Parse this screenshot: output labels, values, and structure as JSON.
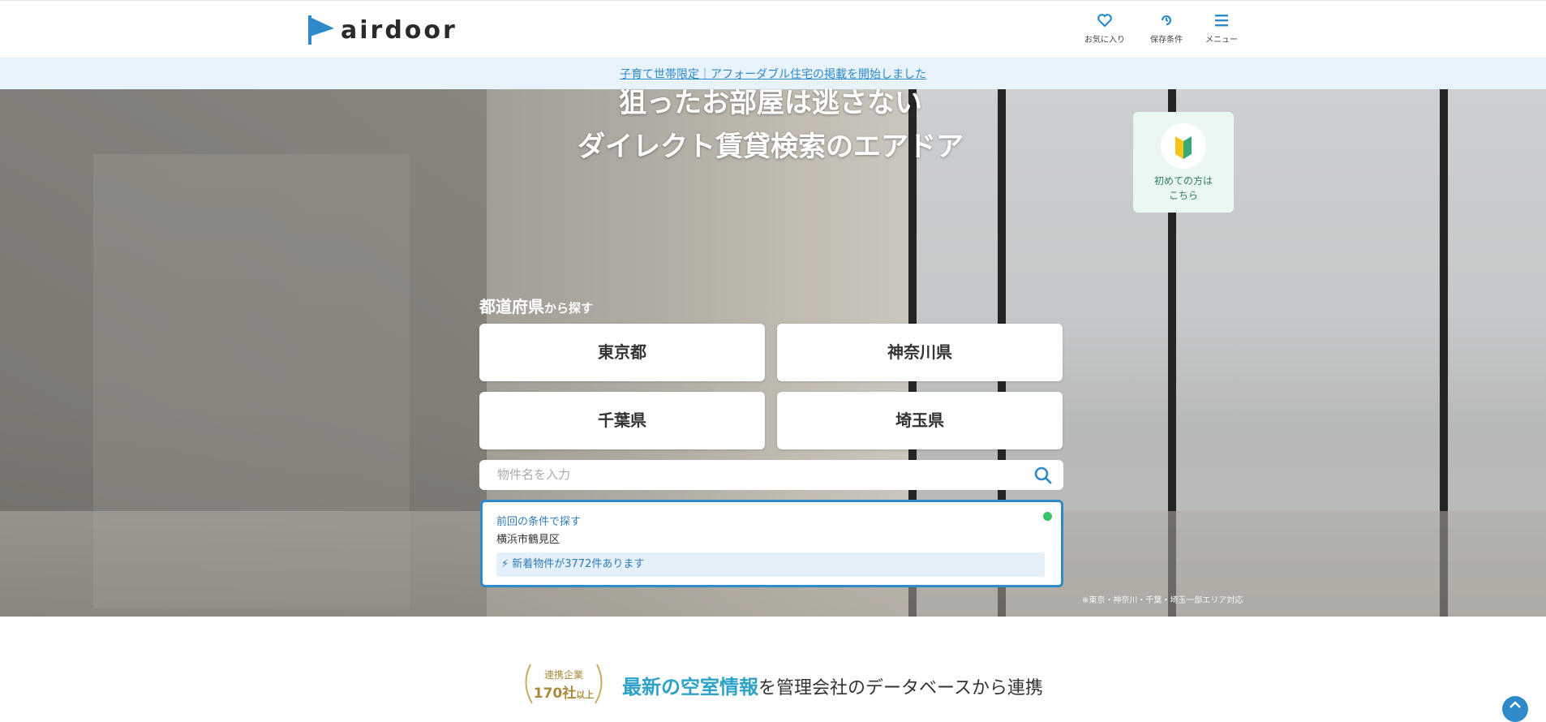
{
  "header": {
    "logo_text": "airdoor",
    "favorites_label": "お気に入り",
    "saved_conditions_label": "保存条件",
    "menu_label": "メニュー"
  },
  "notice": {
    "link_text": "子育て世帯限定｜アフォーダブル住宅の掲載を開始しました"
  },
  "hero": {
    "title_line1": "狙ったお部屋は逃さない",
    "title_line2": "ダイレクト賃貸検索のエアドア",
    "beginner_line1": "初めての方は",
    "beginner_line2": "こちら",
    "pref_label": "都道府県",
    "pref_label_suffix": "から探す",
    "prefectures": [
      "東京都",
      "神奈川県",
      "千葉県",
      "埼玉県"
    ],
    "search_placeholder": "物件名を入力",
    "recent": {
      "title": "前回の条件で探す",
      "area": "横浜市鶴見区",
      "new_listings": "⚡ 新着物件が3772件あります"
    },
    "coverage_note": "※東京・神奈川・千葉・埼玉一部エリア対応"
  },
  "section": {
    "badge_top": "連携企業",
    "badge_count": "170社",
    "badge_suffix": "以上",
    "tagline_highlight": "最新の空室情報",
    "tagline_rest": "を管理会社のデータベースから連携"
  },
  "colors": {
    "accent": "#2e8ac8",
    "highlight": "#2fa3c7",
    "gold": "#a88a3a",
    "new_dot": "#39c46a"
  }
}
